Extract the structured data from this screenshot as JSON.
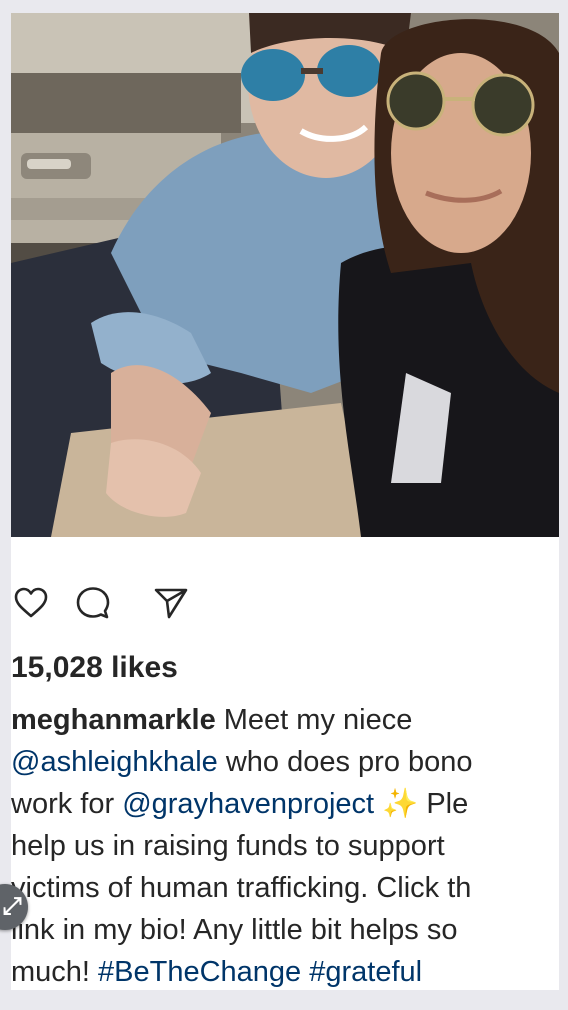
{
  "post": {
    "image_alt": "",
    "likes_text": "15,028 likes",
    "caption": {
      "username": "meghanmarkle",
      "line1_text": " Meet my niece",
      "mention1": "@ashleighkhale",
      "line2_text": " who does pro bono",
      "line3_text": "work for ",
      "mention2": "@grayhavenproject",
      "sparkle": " ✨ ",
      "line3_tail": "Ple",
      "line4": "help us in raising funds to support",
      "line5": "victims of human trafficking. Click th",
      "line6": "link in my bio! Any little bit helps so",
      "line7_text": "much! ",
      "hashtag1": "#BeTheChange",
      "hashtag2": "#grateful"
    },
    "actions": {
      "like_icon": "heart-icon",
      "comment_icon": "comment-icon",
      "share_icon": "send-icon"
    }
  },
  "overlay": {
    "badge_icon": "expand-icon",
    "badge_glyph": "⤢"
  }
}
